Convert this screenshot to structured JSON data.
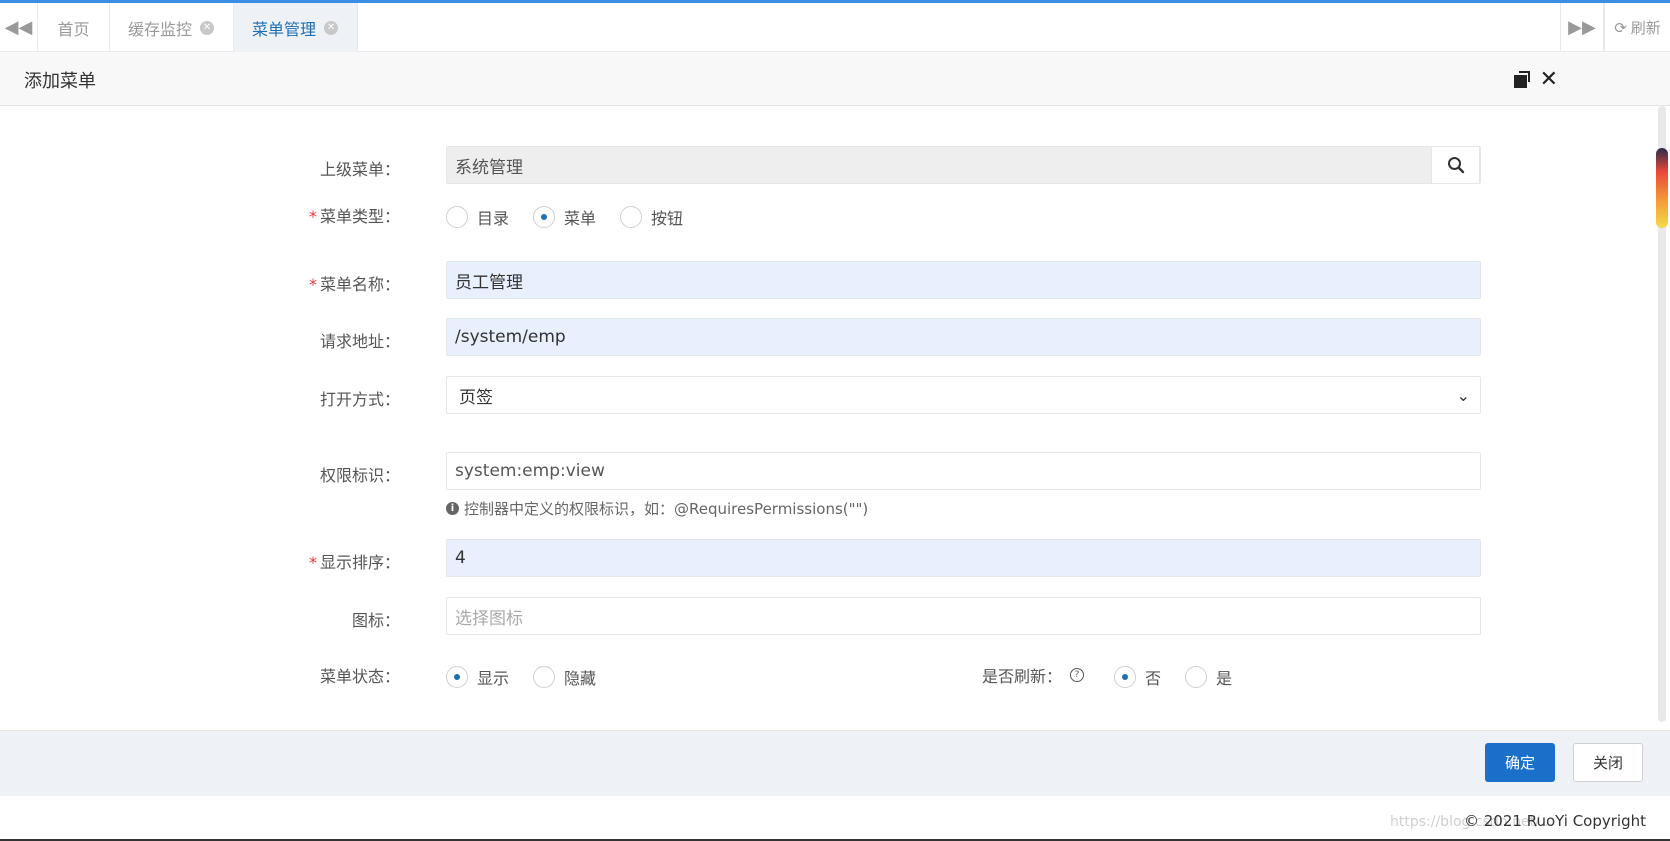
{
  "tabs": {
    "home": "首页",
    "cache": "缓存监控",
    "menu": "菜单管理",
    "refresh": "刷新"
  },
  "dialog": {
    "title": "添加菜单"
  },
  "form": {
    "parent_label": "上级菜单：",
    "parent_value": "系统管理",
    "type_label": "菜单类型：",
    "type_options": [
      "目录",
      "菜单",
      "按钮"
    ],
    "type_selected": "菜单",
    "name_label": "菜单名称：",
    "name_value": "员工管理",
    "url_label": "请求地址：",
    "url_value": "/system/emp",
    "target_label": "打开方式：",
    "target_value": "页签",
    "perms_label": "权限标识：",
    "perms_value": "system:emp:view",
    "perms_help": "控制器中定义的权限标识，如：@RequiresPermissions(\"\")",
    "order_label": "显示排序：",
    "order_value": "4",
    "icon_label": "图标：",
    "icon_placeholder": "选择图标",
    "status_label": "菜单状态：",
    "status_options": [
      "显示",
      "隐藏"
    ],
    "status_selected": "显示",
    "refresh_label": "是否刷新：",
    "refresh_options": [
      "否",
      "是"
    ],
    "refresh_selected": "否"
  },
  "footer": {
    "confirm": "确定",
    "close": "关闭",
    "copyright": "© 2021 RuoYi Copyright",
    "watermark": "https://blog.csdn.net/..."
  },
  "colors": {
    "accent": "#1a6fc9",
    "required": "#e4393c"
  }
}
